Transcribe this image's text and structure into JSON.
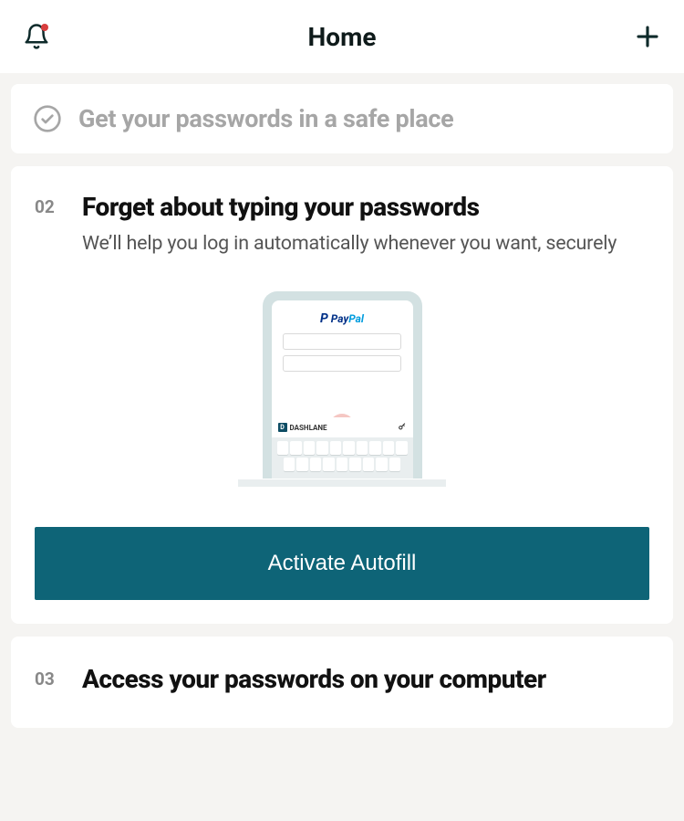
{
  "header": {
    "title": "Home"
  },
  "steps": {
    "completed": {
      "title": "Get your passwords in a safe place"
    },
    "current": {
      "number": "02",
      "title": "Forget about typing your passwords",
      "subtitle": "We’ll help you log in automatically whenever you want, securely",
      "illustration": {
        "app_brand": "PayPal",
        "strip_brand": "DASHLANE"
      },
      "cta": "Activate Autofill"
    },
    "next": {
      "number": "03",
      "title": "Access your passwords on your computer"
    }
  }
}
